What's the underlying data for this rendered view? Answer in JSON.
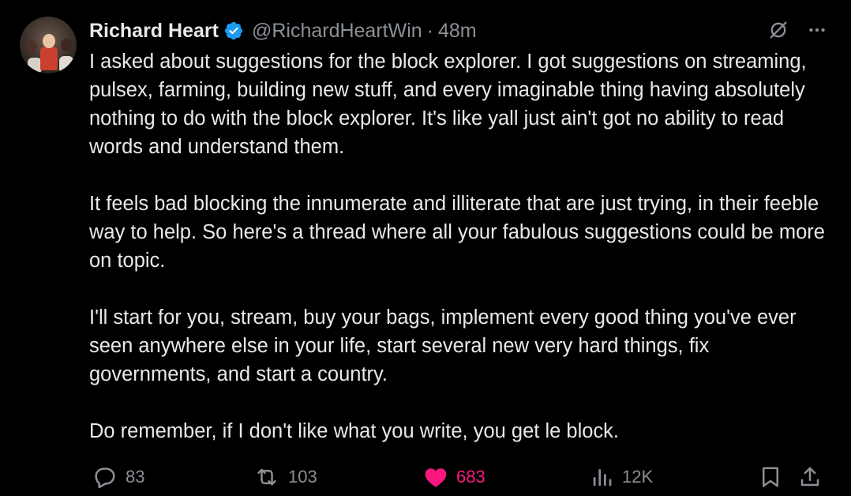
{
  "tweet": {
    "author_name": "Richard Heart",
    "handle": "@RichardHeartWin",
    "separator": "·",
    "time": "48m",
    "paragraphs": [
      "I asked about suggestions for the block explorer. I got suggestions on streaming, pulsex, farming, building new stuff, and every imaginable thing having absolutely nothing to do with the block explorer. It's like yall just ain't got no ability to read words and understand them.",
      "It feels bad blocking the innumerate and illiterate that are just trying, in their feeble way to help. So here's a thread where all your fabulous suggestions could be more on topic.",
      "I'll start for you, stream, buy your bags, implement every good thing you've ever seen anywhere else in your life, start several new very hard things, fix governments, and start a country.",
      "Do remember, if I don't like what you write, you get le block."
    ],
    "actions": {
      "replies": "83",
      "reposts": "103",
      "likes": "683",
      "views": "12K"
    }
  },
  "colors": {
    "background": "#000000",
    "text": "#e7e9ea",
    "muted": "#8b9096",
    "verified": "#1d9bf0",
    "like": "#f91880"
  },
  "icons": [
    "verified-badge-icon",
    "grok-icon",
    "more-icon",
    "reply-icon",
    "repost-icon",
    "like-icon",
    "views-icon",
    "bookmark-icon",
    "share-icon"
  ]
}
